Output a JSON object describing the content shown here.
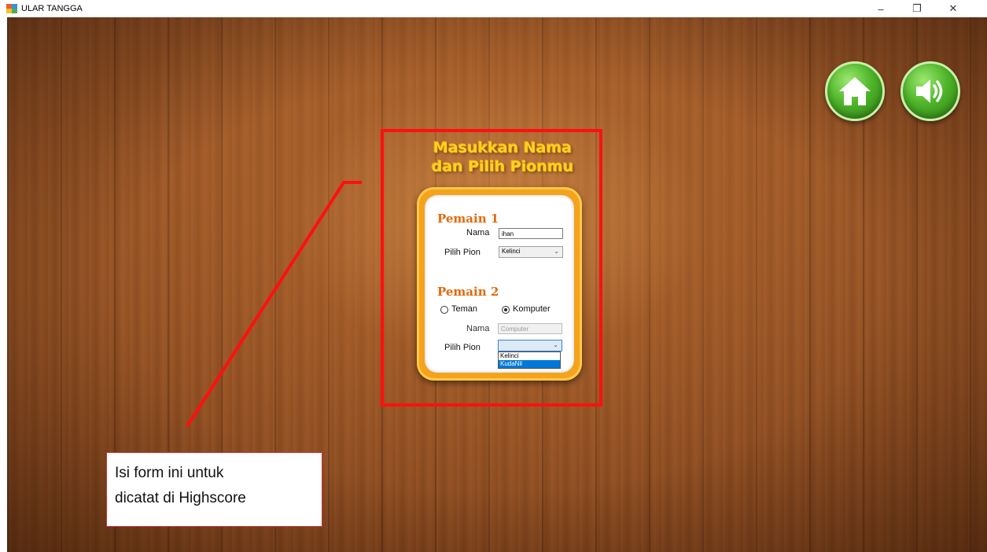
{
  "window": {
    "title": "ULAR TANGGA",
    "minimize_glyph": "–",
    "restore_glyph": "❐",
    "close_glyph": "✕"
  },
  "top_buttons": {
    "home": "home-icon",
    "sound": "speaker-icon"
  },
  "heading": {
    "line1": "Masukkan Nama",
    "line2": "dan Pilih Pionmu"
  },
  "player1": {
    "title": "Pemain 1",
    "name_label": "Nama",
    "name_value": "ihan",
    "pion_label": "Pilih Pion",
    "pion_value": "Kelinci"
  },
  "player2": {
    "title": "Pemain 2",
    "opponent_options": [
      "Teman",
      "Komputer"
    ],
    "opponent_selected": "Komputer",
    "name_label": "Nama",
    "name_value": "Computer",
    "pion_label": "Pilih Pion",
    "pion_value": "",
    "pion_options": [
      "Kelinci",
      "KudaNil"
    ],
    "pion_highlighted": "KudaNil"
  },
  "annotation": {
    "line1": "Isi form ini untuk",
    "line2": "dicatat di Highscore"
  },
  "colors": {
    "highlight": "#ff1010",
    "heading": "#ffd21f",
    "section_title": "#e36a0c",
    "frame": "#f5a21c",
    "button_green": "#4fb52a"
  }
}
